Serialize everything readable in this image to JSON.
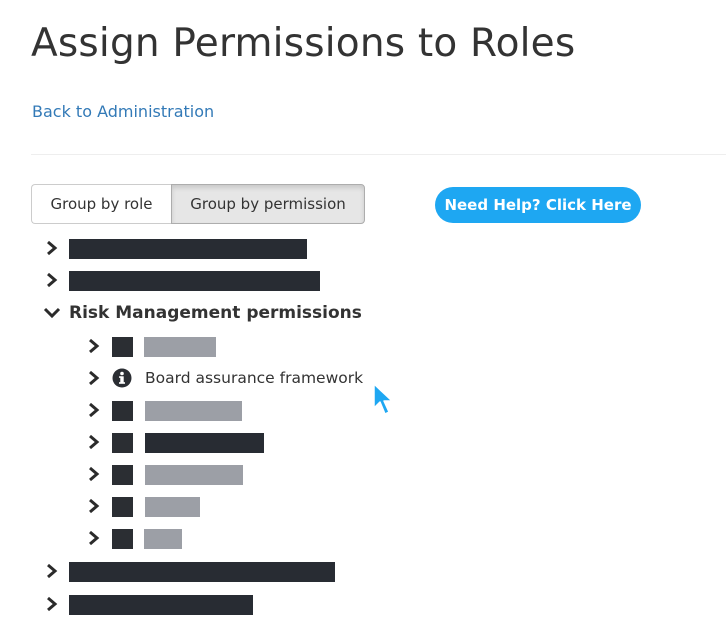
{
  "page": {
    "title": "Assign Permissions to Roles",
    "back_link": "Back to Administration"
  },
  "toolbar": {
    "group_by_role": "Group by role",
    "group_by_permission": "Group by permission",
    "active": "group_by_permission",
    "help_button": "Need Help? Click Here"
  },
  "tree": {
    "expanded_group": "Risk Management permissions",
    "visible_item": "Board assurance framework",
    "redacted_items": "redacted"
  },
  "colors": {
    "link": "#337ab7",
    "help_button": "#1ea7f2",
    "redaction_dark": "#282c33",
    "redaction_light": "#9c9fa6"
  },
  "icons": {
    "collapsed": "chevron-right-icon",
    "expanded": "chevron-down-icon",
    "info": "info-icon",
    "cursor": "mouse-cursor-icon"
  }
}
